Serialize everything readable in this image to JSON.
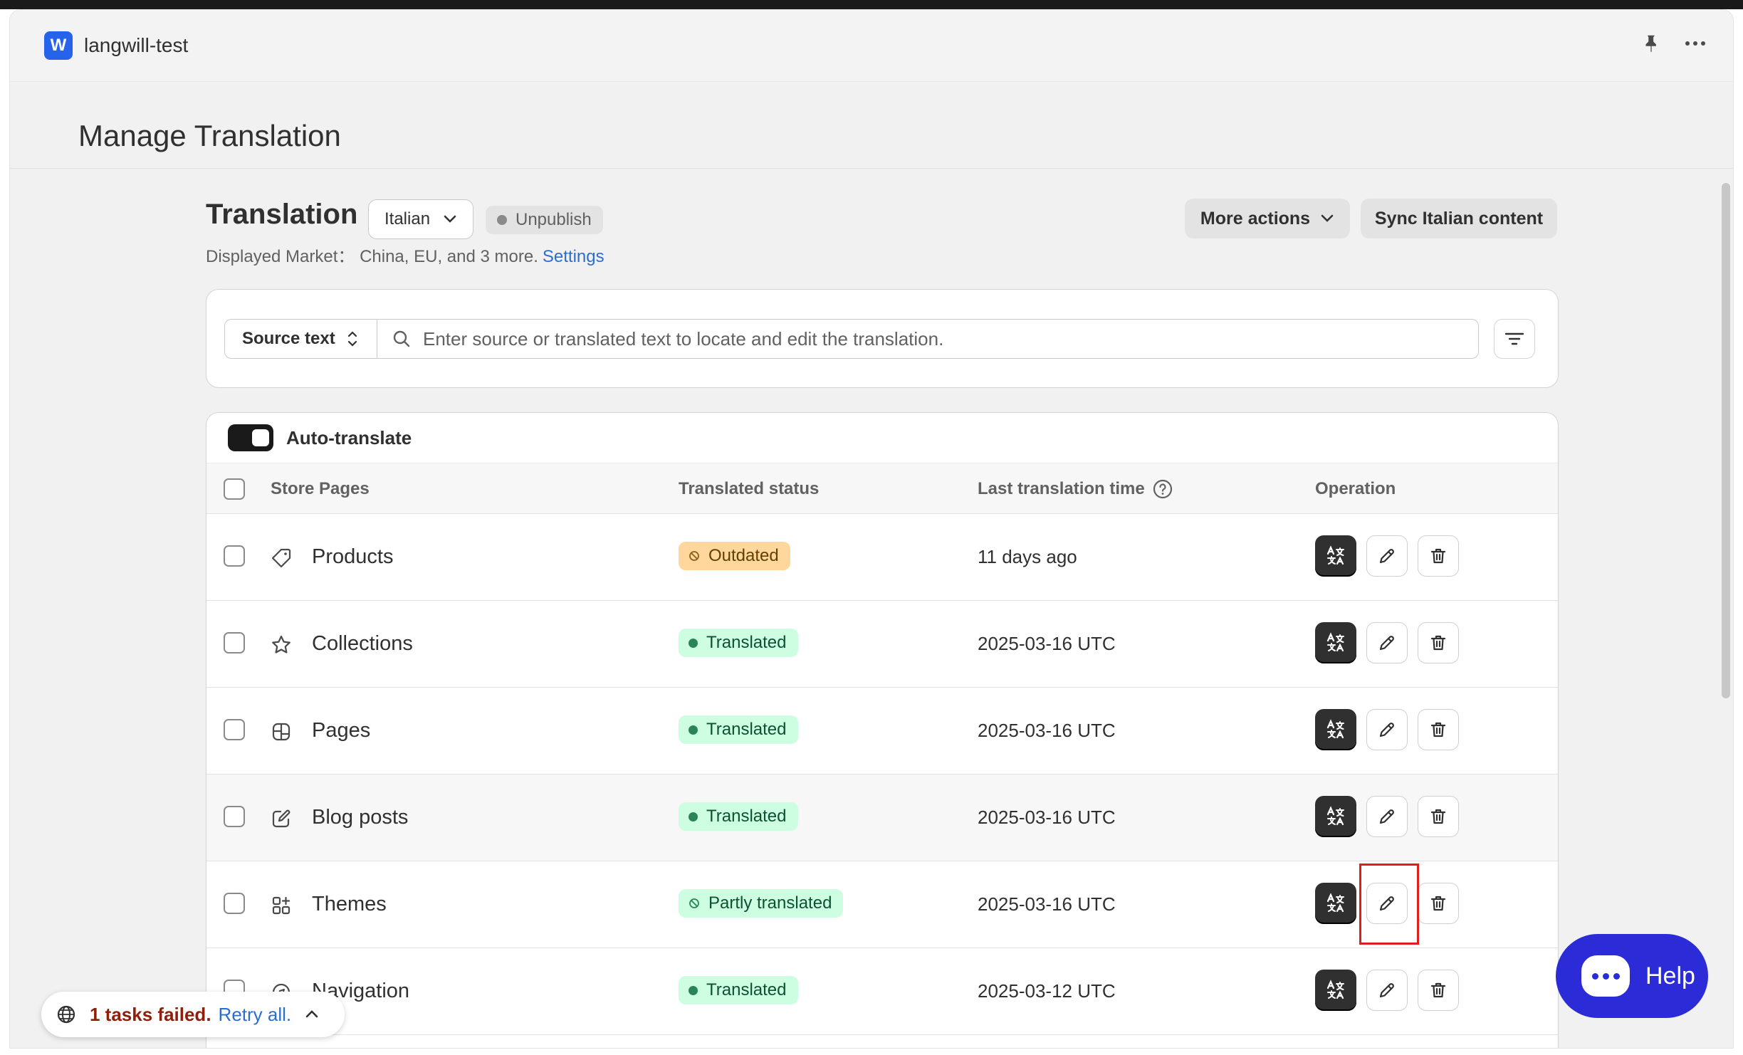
{
  "app": {
    "name": "langwill-test",
    "logo_letter": "W"
  },
  "page": {
    "title": "Manage Translation"
  },
  "translation": {
    "title": "Translation",
    "language": "Italian",
    "publish_status": "Unpublish",
    "market_prefix": "Displayed Market： China, EU, and 3 more.",
    "settings_link": "Settings",
    "more_actions": "More actions",
    "sync_button": "Sync Italian content"
  },
  "search": {
    "source_select": "Source text",
    "placeholder": "Enter source or translated text to locate and edit the translation."
  },
  "table": {
    "auto_translate_label": "Auto-translate",
    "headers": {
      "pages": "Store Pages",
      "status": "Translated status",
      "time": "Last translation time",
      "operation": "Operation"
    },
    "rows": [
      {
        "name": "Products",
        "icon": "tag-icon",
        "status": "Outdated",
        "status_type": "outdated",
        "time": "11 days ago"
      },
      {
        "name": "Collections",
        "icon": "star-icon",
        "status": "Translated",
        "status_type": "translated",
        "time": "2025-03-16 UTC"
      },
      {
        "name": "Pages",
        "icon": "layout-icon",
        "status": "Translated",
        "status_type": "translated",
        "time": "2025-03-16 UTC"
      },
      {
        "name": "Blog posts",
        "icon": "compose-icon",
        "status": "Translated",
        "status_type": "translated",
        "time": "2025-03-16 UTC"
      },
      {
        "name": "Themes",
        "icon": "apps-icon",
        "status": "Partly translated",
        "status_type": "partly",
        "time": "2025-03-16 UTC"
      },
      {
        "name": "Navigation",
        "icon": "compass-icon",
        "status": "Translated",
        "status_type": "translated",
        "time": "2025-03-12 UTC"
      }
    ]
  },
  "toast": {
    "failed_text": "1 tasks failed.",
    "retry_text": "Retry all."
  },
  "help": {
    "label": "Help"
  },
  "colors": {
    "brand": "#2563eb",
    "help": "#2b2bd8",
    "highlight": "#e01e1e"
  }
}
